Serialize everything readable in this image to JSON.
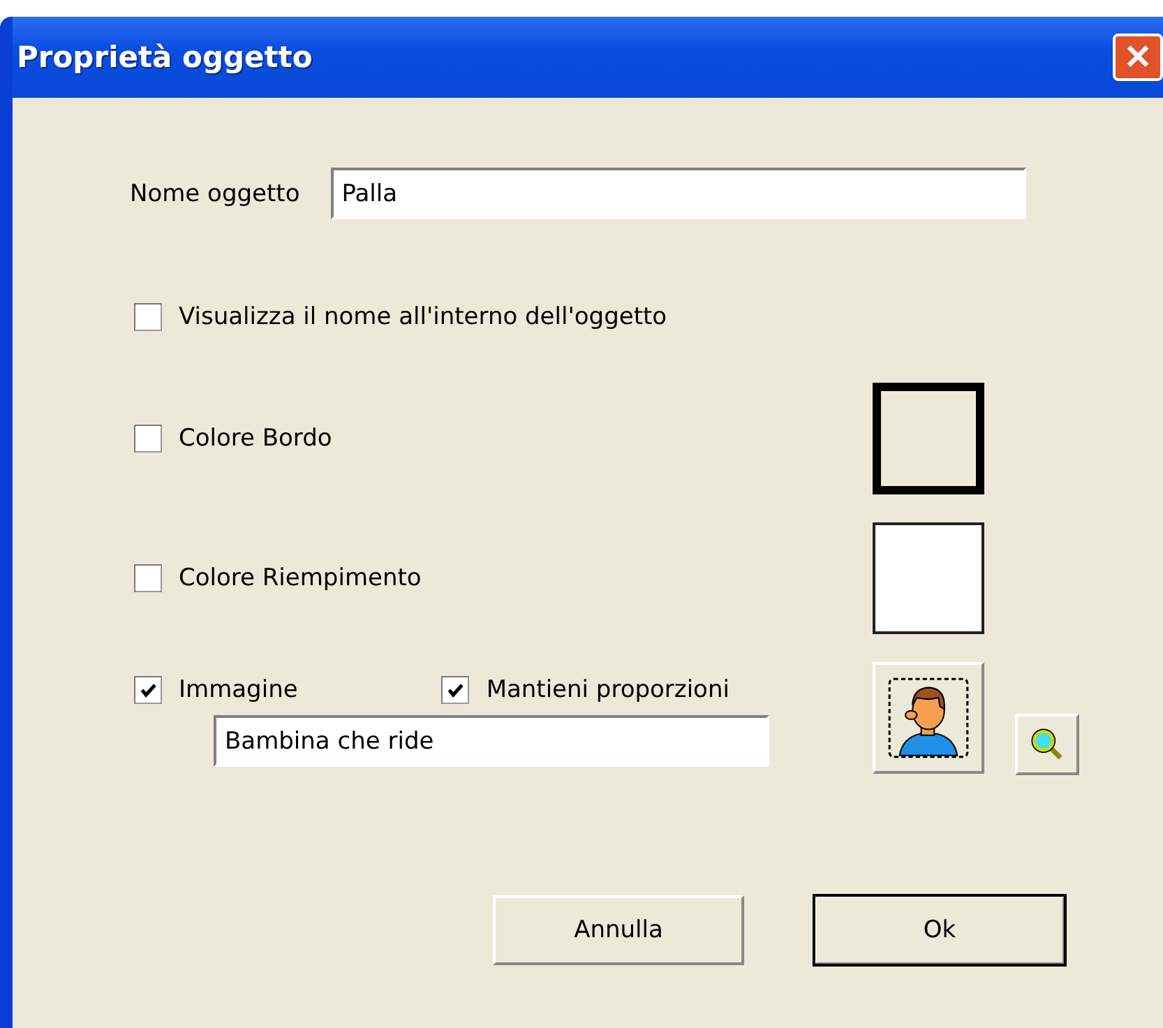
{
  "window": {
    "title": "Proprietà oggetto",
    "close": "✕"
  },
  "name_field": {
    "label": "Nome oggetto",
    "value": "Palla"
  },
  "show_name": {
    "label": "Visualizza il nome all'interno dell'oggetto",
    "checked": false
  },
  "border_color": {
    "label": "Colore Bordo",
    "checked": false,
    "color": "#000000"
  },
  "fill_color": {
    "label": "Colore Riempimento",
    "checked": false,
    "color": "#ffffff"
  },
  "image": {
    "label": "Immagine",
    "checked": true,
    "keep_ratio": {
      "label": "Mantieni proporzioni",
      "checked": true
    },
    "value": "Bambina che ride"
  },
  "buttons": [
    {
      "label": "Annulla",
      "default": false
    },
    {
      "label": "Ok",
      "default": true
    }
  ]
}
